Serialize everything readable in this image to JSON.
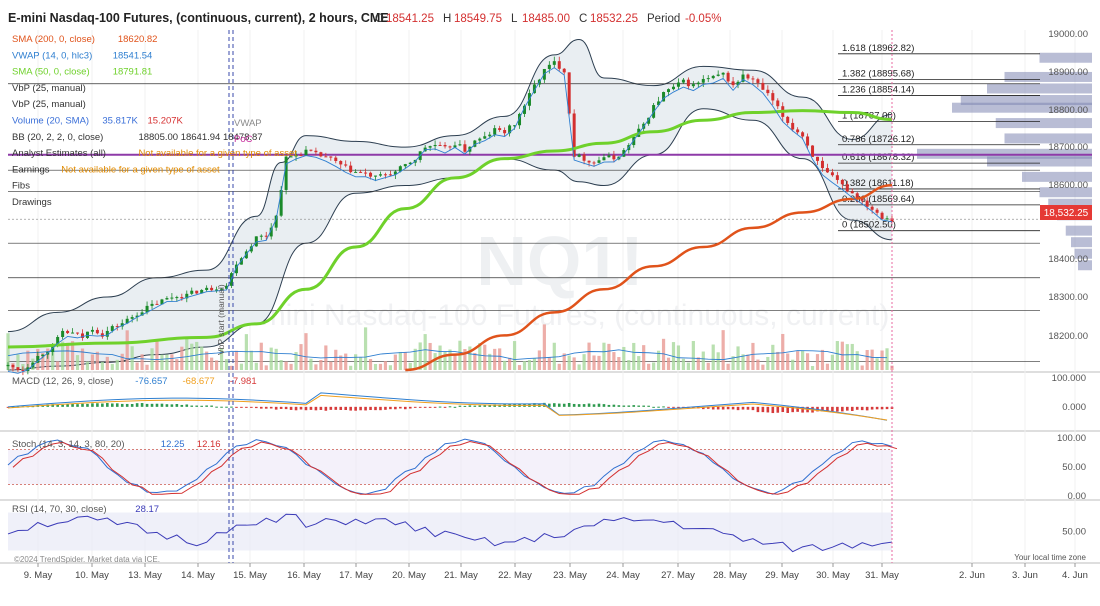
{
  "header": {
    "title": "E-mini Nasdaq-100 Futures, (continuous, current), 2 hours, CME",
    "ohlc": [
      {
        "k": "O",
        "v": "18541.25"
      },
      {
        "k": "H",
        "v": "18549.75"
      },
      {
        "k": "L",
        "v": "18485.00"
      },
      {
        "k": "C",
        "v": "18532.25"
      }
    ],
    "period_label": "Period",
    "period_value": "-0.05%"
  },
  "legend": [
    {
      "name": "SMA (200, 0, close)",
      "vals": [
        "18620.82"
      ],
      "color": "#e0531b",
      "val_color": "#e0531b"
    },
    {
      "name": "VWAP (14, 0, hlc3)",
      "vals": [
        "18541.54"
      ],
      "color": "#2f7fd0",
      "val_color": "#2f7fd0"
    },
    {
      "name": "SMA (50, 0, close)",
      "vals": [
        "18791.81"
      ],
      "color": "#6fd12b",
      "val_color": "#6fd12b"
    },
    {
      "name": "VbP (25, manual)",
      "vals": [],
      "color": "#333333"
    },
    {
      "name": "VbP (25, manual)",
      "vals": [],
      "color": "#333333"
    },
    {
      "name": "Volume (20, SMA)",
      "vals": [
        "35.817K",
        "15.207K"
      ],
      "color": "#3a6fd8",
      "val_color": "#3a6fd8",
      "val_color2": "#d63031"
    },
    {
      "name": "BB (20, 2, 2, 0, close)",
      "vals": [
        "18805.00 18641.94 18478.87"
      ],
      "color": "#333333",
      "val_color": "#333333"
    },
    {
      "name": "Analyst Estimates (all)",
      "vals": [
        "Not available for a given type of asset"
      ],
      "color": "#333333",
      "val_color": "#e08a00"
    },
    {
      "name": "Earnings",
      "vals": [
        "Not available for a given type of asset"
      ],
      "color": "#333333",
      "val_color": "#e08a00"
    },
    {
      "name": "Fibs",
      "vals": [],
      "color": "#333333"
    },
    {
      "name": "Drawings",
      "vals": [],
      "color": "#333333"
    }
  ],
  "watermark": {
    "symbol": "NQ1!",
    "name": "E-mini Nasdaq-100 Futures, (continuous, current)"
  },
  "annotations": {
    "vwap": "VWAP",
    "poc": "PoC",
    "vbp_start": "VbP start (manual)",
    "copyright": "©2024 TrendSpider. Market data via ICE.",
    "timezone": "Your local time zone"
  },
  "price_tag": "18,532.25",
  "colors": {
    "sma200": "#e0531b",
    "sma50": "#6fd12b",
    "vwap": "#2f7fd0",
    "bb_fill": "#e9eef2",
    "up": "#1a8a2a",
    "down": "#d32f2f",
    "vbp": "#7f87b3",
    "poc": "#8e3aa8",
    "macd": "#2f7fd0",
    "signal": "#f0a020",
    "stoch_k": "#2f6fd0",
    "stoch_d": "#d33030",
    "rsi": "#3b3bb8",
    "price_tag": "#e53935"
  },
  "panels": {
    "macd": {
      "label": "MACD (12, 26, 9, close)",
      "vals": [
        "-76.657",
        "-68.677",
        "-7.981"
      ]
    },
    "stoch": {
      "label": "Stoch (14, 3, 14, 3, 80, 20)",
      "vals": [
        "12.25",
        "12.16"
      ]
    },
    "rsi": {
      "label": "RSI (14, 70, 30, close)",
      "vals": [
        "28.17"
      ]
    }
  },
  "chart_data": {
    "type": "candlestick",
    "timeframe": "2 hours",
    "price_axis": {
      "ticks": [
        "19000.00",
        "18900.00",
        "18800.00",
        "18700.00",
        "18600.00",
        "18400.00",
        "18300.00",
        "18200.00"
      ],
      "range": [
        18140,
        19030
      ]
    },
    "x_labels": [
      "9. May",
      "10. May",
      "13. May",
      "14. May",
      "15. May",
      "16. May",
      "17. May",
      "20. May",
      "21. May",
      "22. May",
      "23. May",
      "24. May",
      "27. May",
      "28. May",
      "29. May",
      "30. May",
      "31. May",
      "2. Jun",
      "3. Jun",
      "4. Jun"
    ],
    "fib_levels": [
      {
        "ratio": "1.618",
        "price": 18962.82,
        "label": "1.618 (18962.82)"
      },
      {
        "ratio": "1.382",
        "price": 18895.68,
        "label": "1.382 (18895.68)"
      },
      {
        "ratio": "1.236",
        "price": 18854.14,
        "label": "1.236 (18854.14)"
      },
      {
        "ratio": "1",
        "price": 18787.0,
        "label": "1 (18787.00)"
      },
      {
        "ratio": "0.786",
        "price": 18726.12,
        "label": "0.786 (18726.12)"
      },
      {
        "ratio": "0.618",
        "price": 18678.32,
        "label": "0.618 (18678.32)"
      },
      {
        "ratio": "0.382",
        "price": 18611.18,
        "label": "0.382 (18611.18)"
      },
      {
        "ratio": "0.236",
        "price": 18569.64,
        "label": "0.236 (18569.64)"
      },
      {
        "ratio": "0",
        "price": 18502.5,
        "label": "0 (18502.50)"
      }
    ],
    "close_path": [
      [
        0,
        18150
      ],
      [
        3,
        18140
      ],
      [
        5,
        18165
      ],
      [
        7,
        18185
      ],
      [
        9,
        18200
      ],
      [
        11,
        18240
      ],
      [
        13,
        18235
      ],
      [
        15,
        18225
      ],
      [
        17,
        18250
      ],
      [
        19,
        18232
      ],
      [
        21,
        18250
      ],
      [
        23,
        18262
      ],
      [
        25,
        18278
      ],
      [
        27,
        18295
      ],
      [
        29,
        18308
      ],
      [
        31,
        18320
      ],
      [
        33,
        18330
      ],
      [
        36,
        18335
      ],
      [
        38,
        18345
      ],
      [
        40,
        18350
      ],
      [
        42,
        18355
      ],
      [
        44,
        18360
      ],
      [
        46,
        18420
      ],
      [
        48,
        18450
      ],
      [
        50,
        18485
      ],
      [
        52,
        18490
      ],
      [
        54,
        18540
      ],
      [
        56,
        18690
      ],
      [
        58,
        18700
      ],
      [
        60,
        18710
      ],
      [
        62,
        18700
      ],
      [
        64,
        18695
      ],
      [
        66,
        18680
      ],
      [
        68,
        18665
      ],
      [
        70,
        18655
      ],
      [
        72,
        18650
      ],
      [
        74,
        18640
      ],
      [
        76,
        18650
      ],
      [
        78,
        18655
      ],
      [
        80,
        18672
      ],
      [
        82,
        18690
      ],
      [
        84,
        18720
      ],
      [
        86,
        18725
      ],
      [
        88,
        18715
      ],
      [
        90,
        18730
      ],
      [
        92,
        18712
      ],
      [
        94,
        18735
      ],
      [
        96,
        18745
      ],
      [
        98,
        18765
      ],
      [
        100,
        18760
      ],
      [
        102,
        18780
      ],
      [
        104,
        18830
      ],
      [
        106,
        18880
      ],
      [
        108,
        18920
      ],
      [
        110,
        18940
      ],
      [
        112,
        18920
      ],
      [
        114,
        18700
      ],
      [
        116,
        18690
      ],
      [
        118,
        18680
      ],
      [
        120,
        18695
      ],
      [
        122,
        18690
      ],
      [
        124,
        18710
      ],
      [
        126,
        18745
      ],
      [
        128,
        18780
      ],
      [
        130,
        18825
      ],
      [
        132,
        18860
      ],
      [
        134,
        18875
      ],
      [
        136,
        18890
      ],
      [
        138,
        18880
      ],
      [
        140,
        18895
      ],
      [
        142,
        18900
      ],
      [
        144,
        18910
      ],
      [
        146,
        18880
      ],
      [
        148,
        18905
      ],
      [
        150,
        18895
      ],
      [
        152,
        18870
      ],
      [
        154,
        18840
      ],
      [
        156,
        18800
      ],
      [
        158,
        18770
      ],
      [
        160,
        18750
      ],
      [
        162,
        18700
      ],
      [
        164,
        18660
      ],
      [
        166,
        18640
      ],
      [
        168,
        18620
      ],
      [
        170,
        18600
      ],
      [
        172,
        18580
      ],
      [
        174,
        18560
      ],
      [
        176,
        18540
      ],
      [
        178,
        18532.25
      ]
    ],
    "sma50_path": [
      [
        0,
        18200
      ],
      [
        20,
        18210
      ],
      [
        40,
        18225
      ],
      [
        50,
        18260
      ],
      [
        60,
        18350
      ],
      [
        70,
        18460
      ],
      [
        80,
        18560
      ],
      [
        90,
        18640
      ],
      [
        100,
        18690
      ],
      [
        110,
        18710
      ],
      [
        120,
        18730
      ],
      [
        130,
        18760
      ],
      [
        140,
        18790
      ],
      [
        150,
        18810
      ],
      [
        160,
        18815
      ],
      [
        170,
        18810
      ],
      [
        178,
        18791.81
      ]
    ],
    "sma200_path": [
      [
        80,
        18140
      ],
      [
        90,
        18180
      ],
      [
        100,
        18230
      ],
      [
        110,
        18290
      ],
      [
        120,
        18350
      ],
      [
        130,
        18410
      ],
      [
        140,
        18460
      ],
      [
        150,
        18510
      ],
      [
        160,
        18550
      ],
      [
        170,
        18585
      ],
      [
        178,
        18620.82
      ]
    ],
    "bb_upper": [
      [
        0,
        18240
      ],
      [
        10,
        18290
      ],
      [
        20,
        18330
      ],
      [
        30,
        18380
      ],
      [
        40,
        18400
      ],
      [
        50,
        18540
      ],
      [
        55,
        18680
      ],
      [
        60,
        18750
      ],
      [
        70,
        18735
      ],
      [
        80,
        18720
      ],
      [
        90,
        18750
      ],
      [
        100,
        18800
      ],
      [
        110,
        18960
      ],
      [
        115,
        19000
      ],
      [
        120,
        18900
      ],
      [
        130,
        18880
      ],
      [
        140,
        18930
      ],
      [
        150,
        18920
      ],
      [
        160,
        18850
      ],
      [
        170,
        18740
      ],
      [
        178,
        18805
      ]
    ],
    "bb_lower": [
      [
        0,
        18140
      ],
      [
        10,
        18150
      ],
      [
        20,
        18160
      ],
      [
        30,
        18180
      ],
      [
        40,
        18200
      ],
      [
        50,
        18260
      ],
      [
        60,
        18470
      ],
      [
        70,
        18600
      ],
      [
        80,
        18620
      ],
      [
        90,
        18640
      ],
      [
        100,
        18690
      ],
      [
        110,
        18660
      ],
      [
        115,
        18630
      ],
      [
        120,
        18620
      ],
      [
        130,
        18700
      ],
      [
        140,
        18820
      ],
      [
        150,
        18790
      ],
      [
        160,
        18690
      ],
      [
        170,
        18530
      ],
      [
        178,
        18478.87
      ]
    ],
    "vbp_price": [
      {
        "price": 18950,
        "volume": 0.3
      },
      {
        "price": 18900,
        "volume": 0.5
      },
      {
        "price": 18870,
        "volume": 0.6
      },
      {
        "price": 18840,
        "volume": 0.75
      },
      {
        "price": 18820,
        "volume": 0.8
      },
      {
        "price": 18780,
        "volume": 0.55
      },
      {
        "price": 18740,
        "volume": 0.5
      },
      {
        "price": 18700,
        "volume": 1.0
      },
      {
        "price": 18680,
        "volume": 0.6
      },
      {
        "price": 18640,
        "volume": 0.4
      },
      {
        "price": 18600,
        "volume": 0.3
      },
      {
        "price": 18570,
        "volume": 0.25
      },
      {
        "price": 18540,
        "volume": 0.2
      },
      {
        "price": 18500,
        "volume": 0.15
      },
      {
        "price": 18470,
        "volume": 0.12
      },
      {
        "price": 18440,
        "volume": 0.1
      },
      {
        "price": 18410,
        "volume": 0.08
      }
    ],
    "macd_axis": {
      "ticks": [
        "100.000",
        "0.000"
      ],
      "range": [
        -80,
        110
      ]
    },
    "stoch_axis": {
      "ticks": [
        "100.00",
        "50.00",
        "0.00"
      ],
      "range": [
        0,
        100
      ]
    },
    "rsi_axis": {
      "ticks": [
        "50.00"
      ],
      "range": [
        20,
        80
      ]
    }
  }
}
